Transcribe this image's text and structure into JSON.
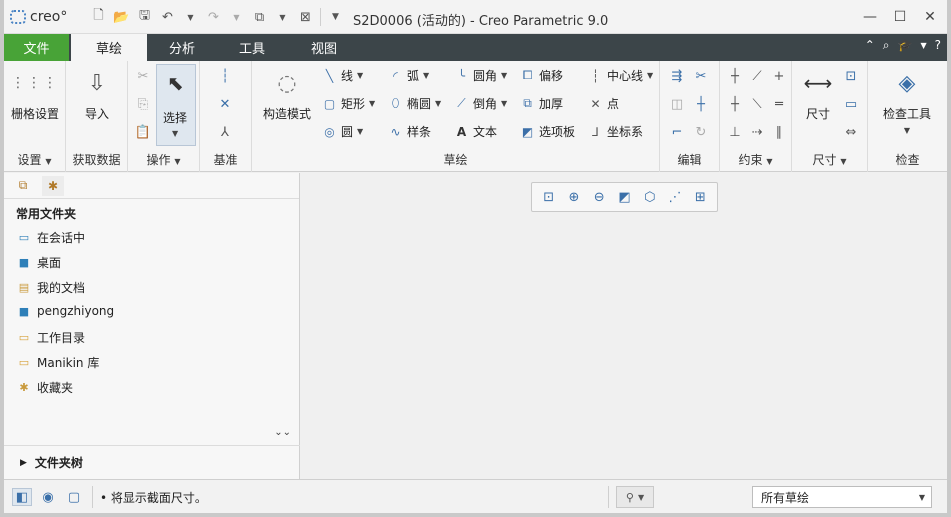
{
  "app": {
    "logo": "creo°",
    "window_title": "S2D0006 (活动的) - Creo Parametric 9.0"
  },
  "tabs": [
    {
      "label": "文件"
    },
    {
      "label": "草绘"
    },
    {
      "label": "分析"
    },
    {
      "label": "工具"
    },
    {
      "label": "视图"
    }
  ],
  "ribbon": {
    "grid_settings": "栅格设置",
    "import": "导入",
    "select": "选择",
    "construction_mode": "构造模式",
    "sketch": {
      "line": "线",
      "arc": "弧",
      "fillet": "圆角",
      "offset": "偏移",
      "centerline": "中心线",
      "rectangle": "矩形",
      "ellipse": "椭圆",
      "chamfer": "倒角",
      "thicken": "加厚",
      "point": "点",
      "circle": "圆",
      "spline": "样条",
      "text": "文本",
      "palette": "选项板",
      "coordsys": "坐标系"
    },
    "dimension": "尺寸",
    "inspect_tools": "检查工具",
    "groups": {
      "settings": "设置",
      "get_data": "获取数据",
      "operations": "操作",
      "datum": "基准",
      "sketching": "草绘",
      "edit": "编辑",
      "constrain": "约束",
      "dimension": "尺寸",
      "inspect": "检查"
    }
  },
  "left_panel": {
    "header": "常用文件夹",
    "items": [
      {
        "label": "在会话中"
      },
      {
        "label": "桌面"
      },
      {
        "label": "我的文档"
      },
      {
        "label": "pengzhiyong"
      },
      {
        "label": "工作目录"
      },
      {
        "label": "Manikin 库"
      },
      {
        "label": "收藏夹"
      }
    ],
    "footer": "文件夹树"
  },
  "status": {
    "message": "将显示截面尺寸。",
    "filter_value": "所有草绘"
  }
}
